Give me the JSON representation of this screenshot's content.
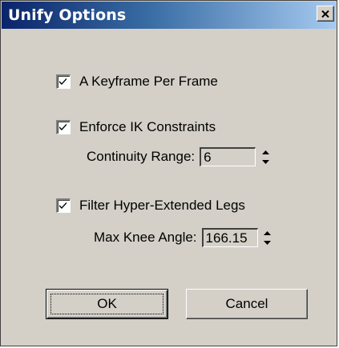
{
  "window": {
    "title": "Unify Options"
  },
  "options": {
    "keyframe_per_frame": {
      "label": "A Keyframe Per Frame",
      "checked": true
    },
    "enforce_ik": {
      "label": "Enforce IK Constraints",
      "checked": true
    },
    "continuity_range": {
      "label": "Continuity Range:",
      "value": "6"
    },
    "filter_legs": {
      "label": "Filter Hyper-Extended Legs",
      "checked": true
    },
    "max_knee_angle": {
      "label": "Max Knee Angle:",
      "value": "166.15"
    }
  },
  "buttons": {
    "ok_label": "OK",
    "cancel_label": "Cancel"
  },
  "colors": {
    "titlebar_start": "#0a246a",
    "titlebar_end": "#a6caf0",
    "face": "#d4d0c8"
  },
  "icons": {
    "close": "close-icon",
    "check": "checkmark-icon",
    "spin_up": "spin-up-arrow-icon",
    "spin_down": "spin-down-arrow-icon"
  }
}
